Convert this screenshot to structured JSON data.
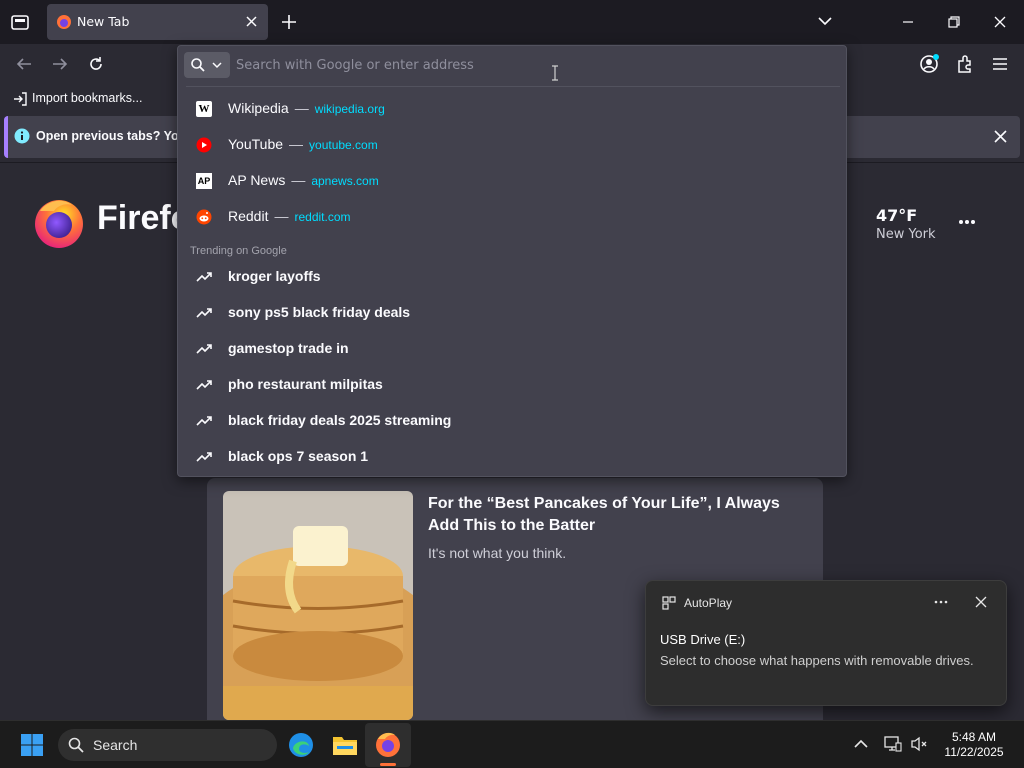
{
  "browser": {
    "tab": {
      "title": "New Tab"
    },
    "bookmarks": {
      "import_label": "Import bookmarks..."
    },
    "infobar": {
      "text": "Open previous tabs? You c"
    }
  },
  "newtab": {
    "brand": "Firefo",
    "weather": {
      "temp": "47°F",
      "location": "New York"
    },
    "story": {
      "title": "For the “Best Pancakes of Your Life”, I Always Add This to the Batter",
      "description": "It's not what you think."
    }
  },
  "urlbar": {
    "placeholder": "Search with Google or enter address",
    "value": "",
    "shortcuts": [
      {
        "title": "Wikipedia",
        "url": "wikipedia.org",
        "icon": "wikipedia-icon"
      },
      {
        "title": "YouTube",
        "url": "youtube.com",
        "icon": "youtube-icon"
      },
      {
        "title": "AP News",
        "url": "apnews.com",
        "icon": "apnews-icon"
      },
      {
        "title": "Reddit",
        "url": "reddit.com",
        "icon": "reddit-icon"
      }
    ],
    "trending_heading": "Trending on Google",
    "trending": [
      "kroger layoffs",
      "sony ps5 black friday deals",
      "gamestop trade in",
      "pho restaurant milpitas",
      "black friday deals 2025 streaming",
      "black ops 7 season 1"
    ],
    "separator": "—",
    "ap_glyph": "AP",
    "wiki_glyph": "W"
  },
  "toast": {
    "app": "AutoPlay",
    "heading": "USB Drive (E:)",
    "body": "Select to choose what happens with removable drives."
  },
  "taskbar": {
    "search_label": "Search",
    "time": "5:48 AM",
    "date": "11/22/2025"
  },
  "colors": {
    "accent": "#00ddff",
    "infobar_accent": "#a680ff",
    "panel": "#42414d",
    "background": "#2b2a33"
  }
}
